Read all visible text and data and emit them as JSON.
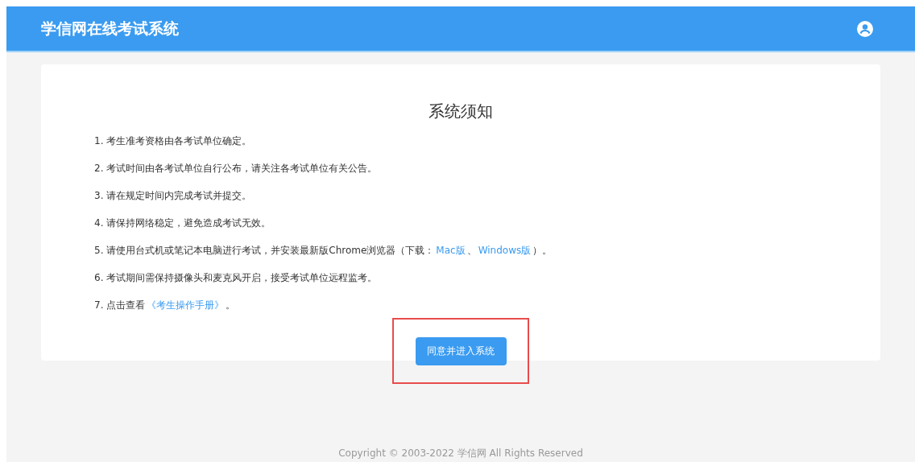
{
  "header": {
    "title": "学信网在线考试系统"
  },
  "notice": {
    "title": "系统须知",
    "items": [
      [
        {
          "text": "1. 考生准考资格由各考试单位确定。",
          "kind": "text"
        }
      ],
      [
        {
          "text": "2. 考试时间由各考试单位自行公布，请关注各考试单位有关公告。",
          "kind": "text"
        }
      ],
      [
        {
          "text": "3. 请在规定时间内完成考试并提交。",
          "kind": "text"
        }
      ],
      [
        {
          "text": "4. 请保持网络稳定，避免造成考试无效。",
          "kind": "text"
        }
      ],
      [
        {
          "text": "5. 请使用台式机或笔记本电脑进行考试，并安装最新版Chrome浏览器（下载：",
          "kind": "text"
        },
        {
          "text": "Mac版",
          "kind": "link"
        },
        {
          "text": "、",
          "kind": "text"
        },
        {
          "text": "Windows版",
          "kind": "link"
        },
        {
          "text": "）。",
          "kind": "text"
        }
      ],
      [
        {
          "text": "6. 考试期间需保持摄像头和麦克风开启，接受考试单位远程监考。",
          "kind": "text"
        }
      ],
      [
        {
          "text": "7. 点击查看",
          "kind": "text"
        },
        {
          "text": "《考生操作手册》",
          "kind": "link"
        },
        {
          "text": "。",
          "kind": "text"
        }
      ]
    ],
    "button": "同意并进入系统"
  },
  "footer": "Copyright © 2003-2022 学信网 All Rights Reserved"
}
